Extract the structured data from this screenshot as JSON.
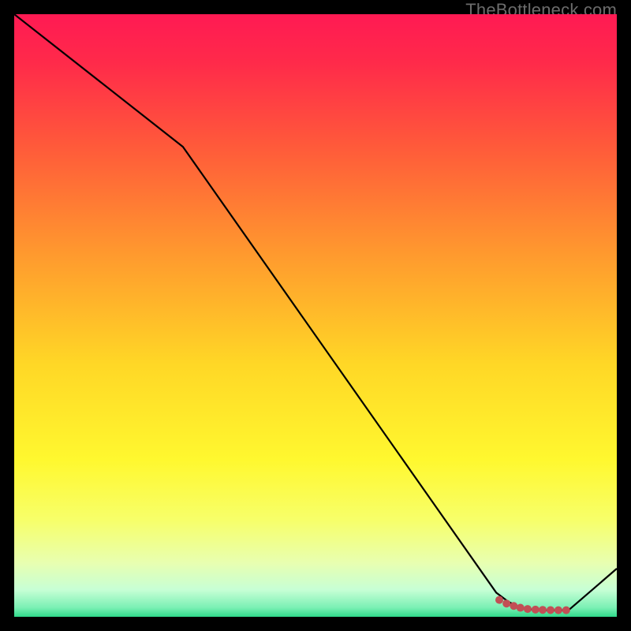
{
  "watermark": "TheBottleneck.com",
  "chart_data": {
    "type": "line",
    "title": "",
    "xlabel": "",
    "ylabel": "",
    "xlim": [
      0,
      100
    ],
    "ylim": [
      0,
      100
    ],
    "series": [
      {
        "name": "curve",
        "x": [
          0,
          28,
          80,
          82,
          84,
          86,
          88,
          90,
          92,
          100
        ],
        "y": [
          100,
          78,
          4,
          2.5,
          1.5,
          1.2,
          1.1,
          1.1,
          1.1,
          8
        ],
        "stroke": "#000000",
        "stroke_width": 2.2
      },
      {
        "name": "markers",
        "x": [
          80.5,
          81.7,
          82.9,
          84.0,
          85.2,
          86.5,
          87.7,
          89.0,
          90.3,
          91.6
        ],
        "y": [
          2.8,
          2.2,
          1.8,
          1.5,
          1.3,
          1.2,
          1.15,
          1.12,
          1.1,
          1.1
        ],
        "stroke": "#c24f55",
        "marker_radius": 5
      }
    ],
    "background_gradient": {
      "stops": [
        {
          "offset": 0.0,
          "color": "#ff1a53"
        },
        {
          "offset": 0.08,
          "color": "#ff2a4a"
        },
        {
          "offset": 0.22,
          "color": "#ff5a3a"
        },
        {
          "offset": 0.4,
          "color": "#ff9a2e"
        },
        {
          "offset": 0.58,
          "color": "#ffd726"
        },
        {
          "offset": 0.74,
          "color": "#fff82f"
        },
        {
          "offset": 0.84,
          "color": "#f7ff6a"
        },
        {
          "offset": 0.91,
          "color": "#e8ffb0"
        },
        {
          "offset": 0.955,
          "color": "#c7ffd5"
        },
        {
          "offset": 0.985,
          "color": "#7af0b4"
        },
        {
          "offset": 1.0,
          "color": "#2fd98a"
        }
      ]
    }
  }
}
